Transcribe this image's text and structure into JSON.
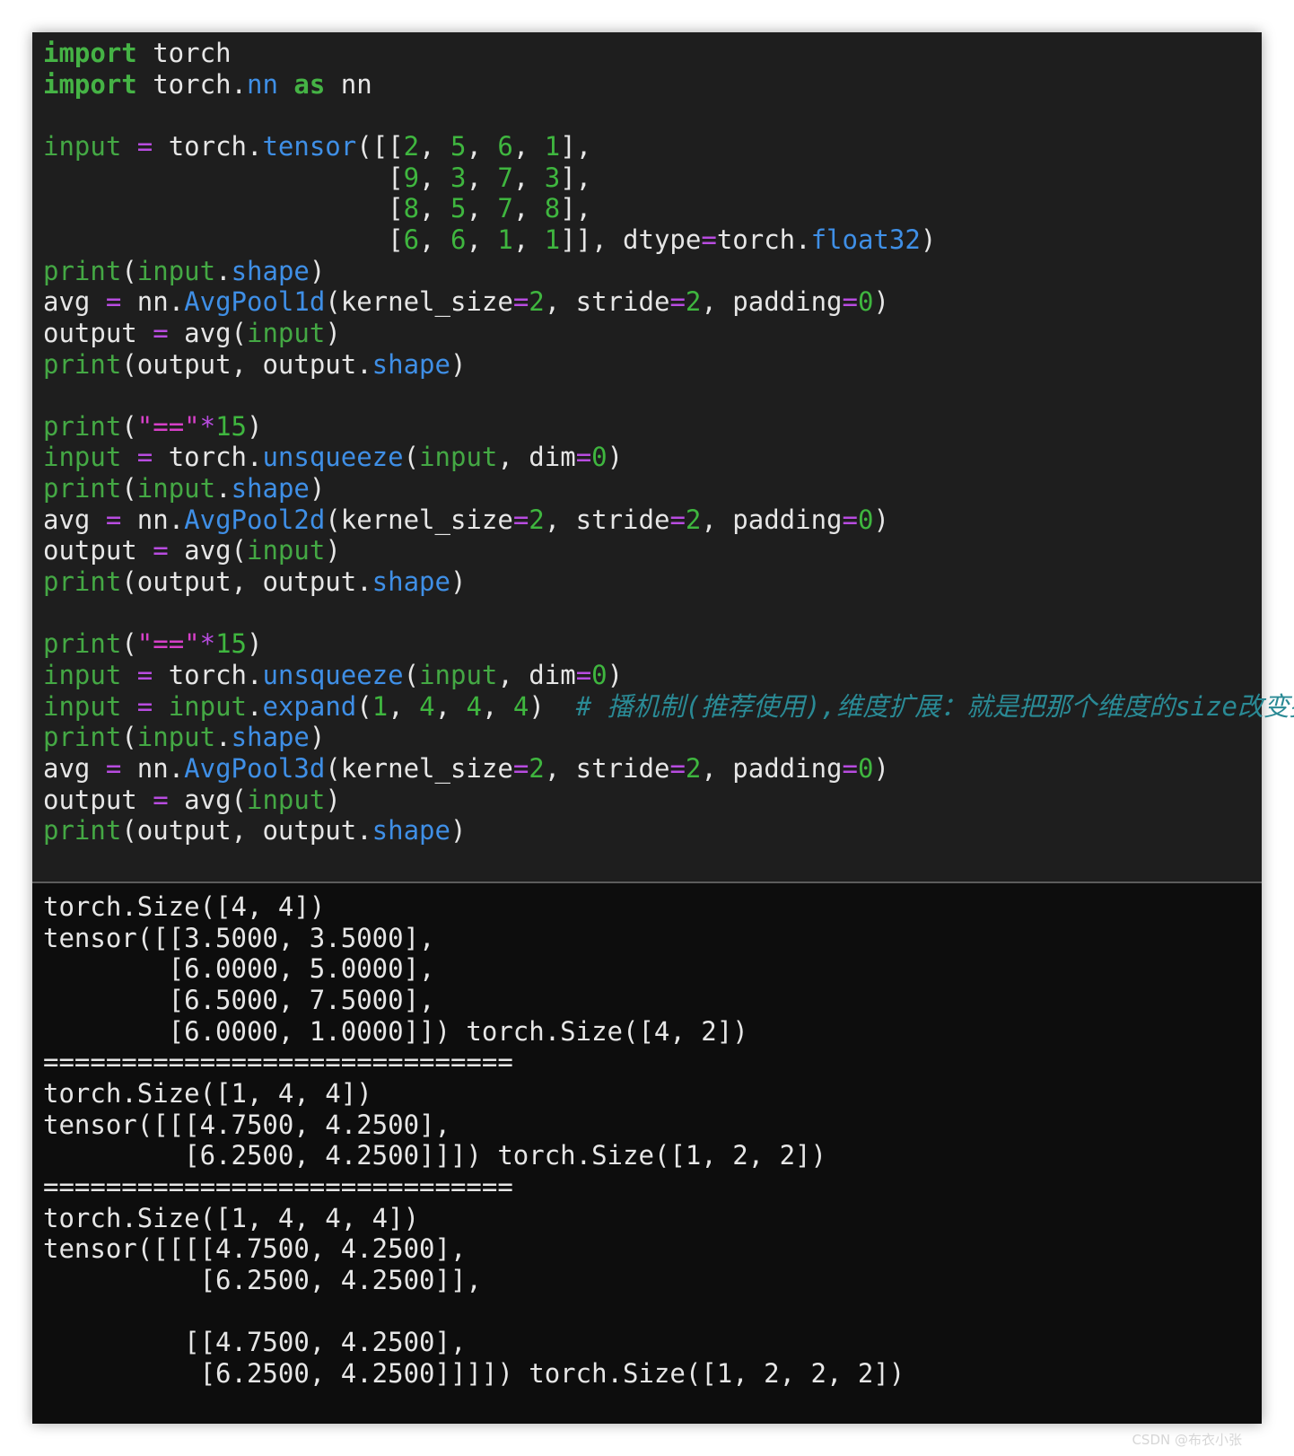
{
  "code_lines": [
    [
      {
        "t": "import",
        "c": "kw"
      },
      {
        "t": " torch",
        "c": "pl"
      }
    ],
    [
      {
        "t": "import",
        "c": "kw"
      },
      {
        "t": " torch.",
        "c": "pl"
      },
      {
        "t": "nn",
        "c": "fn"
      },
      {
        "t": " ",
        "c": "pl"
      },
      {
        "t": "as",
        "c": "kw"
      },
      {
        "t": " nn",
        "c": "pl"
      }
    ],
    [],
    [
      {
        "t": "input",
        "c": "bi"
      },
      {
        "t": " ",
        "c": "pl"
      },
      {
        "t": "=",
        "c": "op"
      },
      {
        "t": " torch.",
        "c": "pl"
      },
      {
        "t": "tensor",
        "c": "fn"
      },
      {
        "t": "([[",
        "c": "pl"
      },
      {
        "t": "2",
        "c": "num"
      },
      {
        "t": ", ",
        "c": "pl"
      },
      {
        "t": "5",
        "c": "num"
      },
      {
        "t": ", ",
        "c": "pl"
      },
      {
        "t": "6",
        "c": "num"
      },
      {
        "t": ", ",
        "c": "pl"
      },
      {
        "t": "1",
        "c": "num"
      },
      {
        "t": "],",
        "c": "pl"
      }
    ],
    [
      {
        "t": "                      [",
        "c": "pl"
      },
      {
        "t": "9",
        "c": "num"
      },
      {
        "t": ", ",
        "c": "pl"
      },
      {
        "t": "3",
        "c": "num"
      },
      {
        "t": ", ",
        "c": "pl"
      },
      {
        "t": "7",
        "c": "num"
      },
      {
        "t": ", ",
        "c": "pl"
      },
      {
        "t": "3",
        "c": "num"
      },
      {
        "t": "],",
        "c": "pl"
      }
    ],
    [
      {
        "t": "                      [",
        "c": "pl"
      },
      {
        "t": "8",
        "c": "num"
      },
      {
        "t": ", ",
        "c": "pl"
      },
      {
        "t": "5",
        "c": "num"
      },
      {
        "t": ", ",
        "c": "pl"
      },
      {
        "t": "7",
        "c": "num"
      },
      {
        "t": ", ",
        "c": "pl"
      },
      {
        "t": "8",
        "c": "num"
      },
      {
        "t": "],",
        "c": "pl"
      }
    ],
    [
      {
        "t": "                      [",
        "c": "pl"
      },
      {
        "t": "6",
        "c": "num"
      },
      {
        "t": ", ",
        "c": "pl"
      },
      {
        "t": "6",
        "c": "num"
      },
      {
        "t": ", ",
        "c": "pl"
      },
      {
        "t": "1",
        "c": "num"
      },
      {
        "t": ", ",
        "c": "pl"
      },
      {
        "t": "1",
        "c": "num"
      },
      {
        "t": "]], dtype",
        "c": "pl"
      },
      {
        "t": "=",
        "c": "op"
      },
      {
        "t": "torch.",
        "c": "pl"
      },
      {
        "t": "float32",
        "c": "fn"
      },
      {
        "t": ")",
        "c": "pl"
      }
    ],
    [
      {
        "t": "print",
        "c": "bi"
      },
      {
        "t": "(",
        "c": "pl"
      },
      {
        "t": "input",
        "c": "bi"
      },
      {
        "t": ".",
        "c": "pl"
      },
      {
        "t": "shape",
        "c": "fn"
      },
      {
        "t": ")",
        "c": "pl"
      }
    ],
    [
      {
        "t": "avg ",
        "c": "pl"
      },
      {
        "t": "=",
        "c": "op"
      },
      {
        "t": " nn.",
        "c": "pl"
      },
      {
        "t": "AvgPool1d",
        "c": "fn"
      },
      {
        "t": "(kernel_size",
        "c": "pl"
      },
      {
        "t": "=",
        "c": "op"
      },
      {
        "t": "2",
        "c": "num"
      },
      {
        "t": ", stride",
        "c": "pl"
      },
      {
        "t": "=",
        "c": "op"
      },
      {
        "t": "2",
        "c": "num"
      },
      {
        "t": ", padding",
        "c": "pl"
      },
      {
        "t": "=",
        "c": "op"
      },
      {
        "t": "0",
        "c": "num"
      },
      {
        "t": ")",
        "c": "pl"
      }
    ],
    [
      {
        "t": "output ",
        "c": "pl"
      },
      {
        "t": "=",
        "c": "op"
      },
      {
        "t": " avg(",
        "c": "pl"
      },
      {
        "t": "input",
        "c": "bi"
      },
      {
        "t": ")",
        "c": "pl"
      }
    ],
    [
      {
        "t": "print",
        "c": "bi"
      },
      {
        "t": "(output, output.",
        "c": "pl"
      },
      {
        "t": "shape",
        "c": "fn"
      },
      {
        "t": ")",
        "c": "pl"
      }
    ],
    [],
    [
      {
        "t": "print",
        "c": "bi"
      },
      {
        "t": "(",
        "c": "pl"
      },
      {
        "t": "\"==\"",
        "c": "str"
      },
      {
        "t": "*",
        "c": "op"
      },
      {
        "t": "15",
        "c": "num"
      },
      {
        "t": ")",
        "c": "pl"
      }
    ],
    [
      {
        "t": "input",
        "c": "bi"
      },
      {
        "t": " ",
        "c": "pl"
      },
      {
        "t": "=",
        "c": "op"
      },
      {
        "t": " torch.",
        "c": "pl"
      },
      {
        "t": "unsqueeze",
        "c": "fn"
      },
      {
        "t": "(",
        "c": "pl"
      },
      {
        "t": "input",
        "c": "bi"
      },
      {
        "t": ", dim",
        "c": "pl"
      },
      {
        "t": "=",
        "c": "op"
      },
      {
        "t": "0",
        "c": "num"
      },
      {
        "t": ")",
        "c": "pl"
      }
    ],
    [
      {
        "t": "print",
        "c": "bi"
      },
      {
        "t": "(",
        "c": "pl"
      },
      {
        "t": "input",
        "c": "bi"
      },
      {
        "t": ".",
        "c": "pl"
      },
      {
        "t": "shape",
        "c": "fn"
      },
      {
        "t": ")",
        "c": "pl"
      }
    ],
    [
      {
        "t": "avg ",
        "c": "pl"
      },
      {
        "t": "=",
        "c": "op"
      },
      {
        "t": " nn.",
        "c": "pl"
      },
      {
        "t": "AvgPool2d",
        "c": "fn"
      },
      {
        "t": "(kernel_size",
        "c": "pl"
      },
      {
        "t": "=",
        "c": "op"
      },
      {
        "t": "2",
        "c": "num"
      },
      {
        "t": ", stride",
        "c": "pl"
      },
      {
        "t": "=",
        "c": "op"
      },
      {
        "t": "2",
        "c": "num"
      },
      {
        "t": ", padding",
        "c": "pl"
      },
      {
        "t": "=",
        "c": "op"
      },
      {
        "t": "0",
        "c": "num"
      },
      {
        "t": ")",
        "c": "pl"
      }
    ],
    [
      {
        "t": "output ",
        "c": "pl"
      },
      {
        "t": "=",
        "c": "op"
      },
      {
        "t": " avg(",
        "c": "pl"
      },
      {
        "t": "input",
        "c": "bi"
      },
      {
        "t": ")",
        "c": "pl"
      }
    ],
    [
      {
        "t": "print",
        "c": "bi"
      },
      {
        "t": "(output, output.",
        "c": "pl"
      },
      {
        "t": "shape",
        "c": "fn"
      },
      {
        "t": ")",
        "c": "pl"
      }
    ],
    [],
    [
      {
        "t": "print",
        "c": "bi"
      },
      {
        "t": "(",
        "c": "pl"
      },
      {
        "t": "\"==\"",
        "c": "str"
      },
      {
        "t": "*",
        "c": "op"
      },
      {
        "t": "15",
        "c": "num"
      },
      {
        "t": ")",
        "c": "pl"
      }
    ],
    [
      {
        "t": "input",
        "c": "bi"
      },
      {
        "t": " ",
        "c": "pl"
      },
      {
        "t": "=",
        "c": "op"
      },
      {
        "t": " torch.",
        "c": "pl"
      },
      {
        "t": "unsqueeze",
        "c": "fn"
      },
      {
        "t": "(",
        "c": "pl"
      },
      {
        "t": "input",
        "c": "bi"
      },
      {
        "t": ", dim",
        "c": "pl"
      },
      {
        "t": "=",
        "c": "op"
      },
      {
        "t": "0",
        "c": "num"
      },
      {
        "t": ")",
        "c": "pl"
      }
    ],
    [
      {
        "t": "input",
        "c": "bi"
      },
      {
        "t": " ",
        "c": "pl"
      },
      {
        "t": "=",
        "c": "op"
      },
      {
        "t": " ",
        "c": "pl"
      },
      {
        "t": "input",
        "c": "bi"
      },
      {
        "t": ".",
        "c": "pl"
      },
      {
        "t": "expand",
        "c": "fn"
      },
      {
        "t": "(",
        "c": "pl"
      },
      {
        "t": "1",
        "c": "num"
      },
      {
        "t": ", ",
        "c": "pl"
      },
      {
        "t": "4",
        "c": "num"
      },
      {
        "t": ", ",
        "c": "pl"
      },
      {
        "t": "4",
        "c": "num"
      },
      {
        "t": ", ",
        "c": "pl"
      },
      {
        "t": "4",
        "c": "num"
      },
      {
        "t": ")  ",
        "c": "pl"
      },
      {
        "t": "# 播机制(推荐使用),维度扩展：就是把那个维度的size改变掉",
        "c": "cmt"
      }
    ],
    [
      {
        "t": "print",
        "c": "bi"
      },
      {
        "t": "(",
        "c": "pl"
      },
      {
        "t": "input",
        "c": "bi"
      },
      {
        "t": ".",
        "c": "pl"
      },
      {
        "t": "shape",
        "c": "fn"
      },
      {
        "t": ")",
        "c": "pl"
      }
    ],
    [
      {
        "t": "avg ",
        "c": "pl"
      },
      {
        "t": "=",
        "c": "op"
      },
      {
        "t": " nn.",
        "c": "pl"
      },
      {
        "t": "AvgPool3d",
        "c": "fn"
      },
      {
        "t": "(kernel_size",
        "c": "pl"
      },
      {
        "t": "=",
        "c": "op"
      },
      {
        "t": "2",
        "c": "num"
      },
      {
        "t": ", stride",
        "c": "pl"
      },
      {
        "t": "=",
        "c": "op"
      },
      {
        "t": "2",
        "c": "num"
      },
      {
        "t": ", padding",
        "c": "pl"
      },
      {
        "t": "=",
        "c": "op"
      },
      {
        "t": "0",
        "c": "num"
      },
      {
        "t": ")",
        "c": "pl"
      }
    ],
    [
      {
        "t": "output ",
        "c": "pl"
      },
      {
        "t": "=",
        "c": "op"
      },
      {
        "t": " avg(",
        "c": "pl"
      },
      {
        "t": "input",
        "c": "bi"
      },
      {
        "t": ")",
        "c": "pl"
      }
    ],
    [
      {
        "t": "print",
        "c": "bi"
      },
      {
        "t": "(output, output.",
        "c": "pl"
      },
      {
        "t": "shape",
        "c": "fn"
      },
      {
        "t": ")",
        "c": "pl"
      }
    ]
  ],
  "output_lines": [
    "torch.Size([4, 4])",
    "tensor([[3.5000, 3.5000],",
    "        [6.0000, 5.0000],",
    "        [6.5000, 7.5000],",
    "        [6.0000, 1.0000]]) torch.Size([4, 2])",
    "==============================",
    "torch.Size([1, 4, 4])",
    "tensor([[[4.7500, 4.2500],",
    "         [6.2500, 4.2500]]]) torch.Size([1, 2, 2])",
    "==============================",
    "torch.Size([1, 4, 4, 4])",
    "tensor([[[[4.7500, 4.2500],",
    "          [6.2500, 4.2500]],",
    "",
    "         [[4.7500, 4.2500],",
    "          [6.2500, 4.2500]]]]) torch.Size([1, 2, 2, 2])"
  ],
  "watermark": "CSDN @布衣小张"
}
